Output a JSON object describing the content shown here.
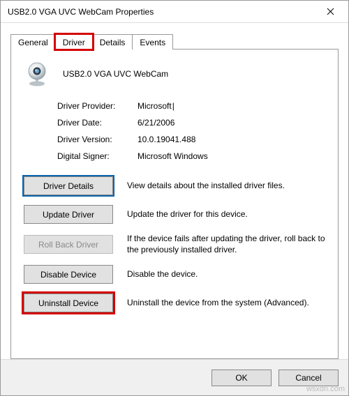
{
  "window": {
    "title": "USB2.0 VGA UVC WebCam Properties"
  },
  "tabs": {
    "general": "General",
    "driver": "Driver",
    "details": "Details",
    "events": "Events",
    "active": "driver"
  },
  "device": {
    "name": "USB2.0 VGA UVC WebCam"
  },
  "info": {
    "provider_label": "Driver Provider:",
    "provider_value": "Microsoft",
    "date_label": "Driver Date:",
    "date_value": "6/21/2006",
    "version_label": "Driver Version:",
    "version_value": "10.0.19041.488",
    "signer_label": "Digital Signer:",
    "signer_value": "Microsoft Windows"
  },
  "actions": {
    "details_btn": "Driver Details",
    "details_desc": "View details about the installed driver files.",
    "update_btn": "Update Driver",
    "update_desc": "Update the driver for this device.",
    "rollback_btn": "Roll Back Driver",
    "rollback_desc": "If the device fails after updating the driver, roll back to the previously installed driver.",
    "disable_btn": "Disable Device",
    "disable_desc": "Disable the device.",
    "uninstall_btn": "Uninstall Device",
    "uninstall_desc": "Uninstall the device from the system (Advanced)."
  },
  "footer": {
    "ok": "OK",
    "cancel": "Cancel"
  },
  "watermark": "wsxdn.com"
}
